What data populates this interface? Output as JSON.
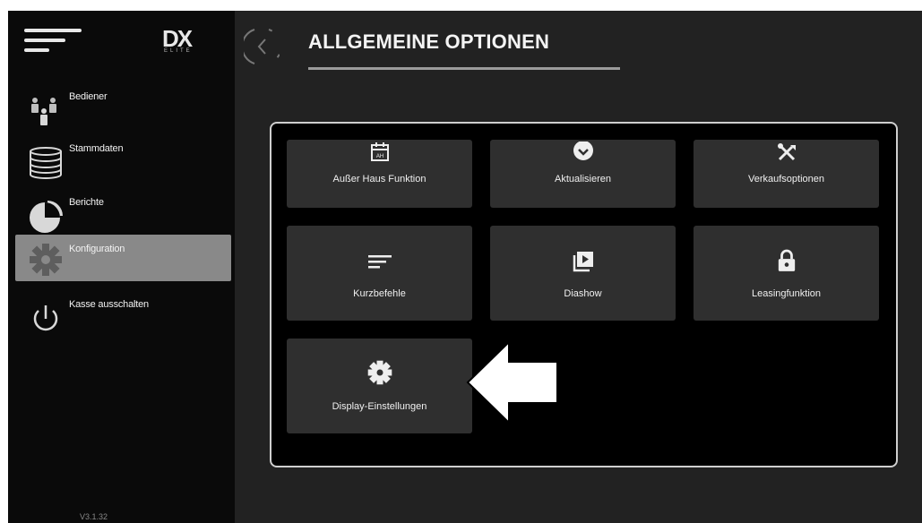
{
  "sidebar": {
    "logo": "DX",
    "logo_sub": "ELITE",
    "items": [
      {
        "label": "Bediener",
        "icon": "users-icon"
      },
      {
        "label": "Stammdaten",
        "icon": "database-icon"
      },
      {
        "label": "Berichte",
        "icon": "pie-chart-icon"
      },
      {
        "label": "Konfiguration",
        "icon": "gear-icon",
        "active": true
      },
      {
        "label": "Kasse ausschalten",
        "icon": "power-icon"
      }
    ],
    "version": "V3.1.32"
  },
  "header": {
    "title": "ALLGEMEINE OPTIONEN"
  },
  "tiles": [
    {
      "label": "Außer Haus Funktion",
      "icon": "calendar-icon",
      "calendar_text": "AH"
    },
    {
      "label": "Aktualisieren",
      "icon": "update-icon"
    },
    {
      "label": "Verkaufsoptionen",
      "icon": "tools-icon"
    },
    {
      "label": "Kurzbefehle",
      "icon": "shortcut-lines-icon"
    },
    {
      "label": "Diashow",
      "icon": "slideshow-icon"
    },
    {
      "label": "Leasingfunktion",
      "icon": "lock-icon"
    },
    {
      "label": "Display-Einstellungen",
      "icon": "gear-icon"
    }
  ],
  "colors": {
    "sidebar_bg": "#0a0a0a",
    "content_bg": "#222222",
    "panel_bg": "#000000",
    "tile_bg": "#2f2f2f",
    "active_item_bg": "#898989"
  }
}
